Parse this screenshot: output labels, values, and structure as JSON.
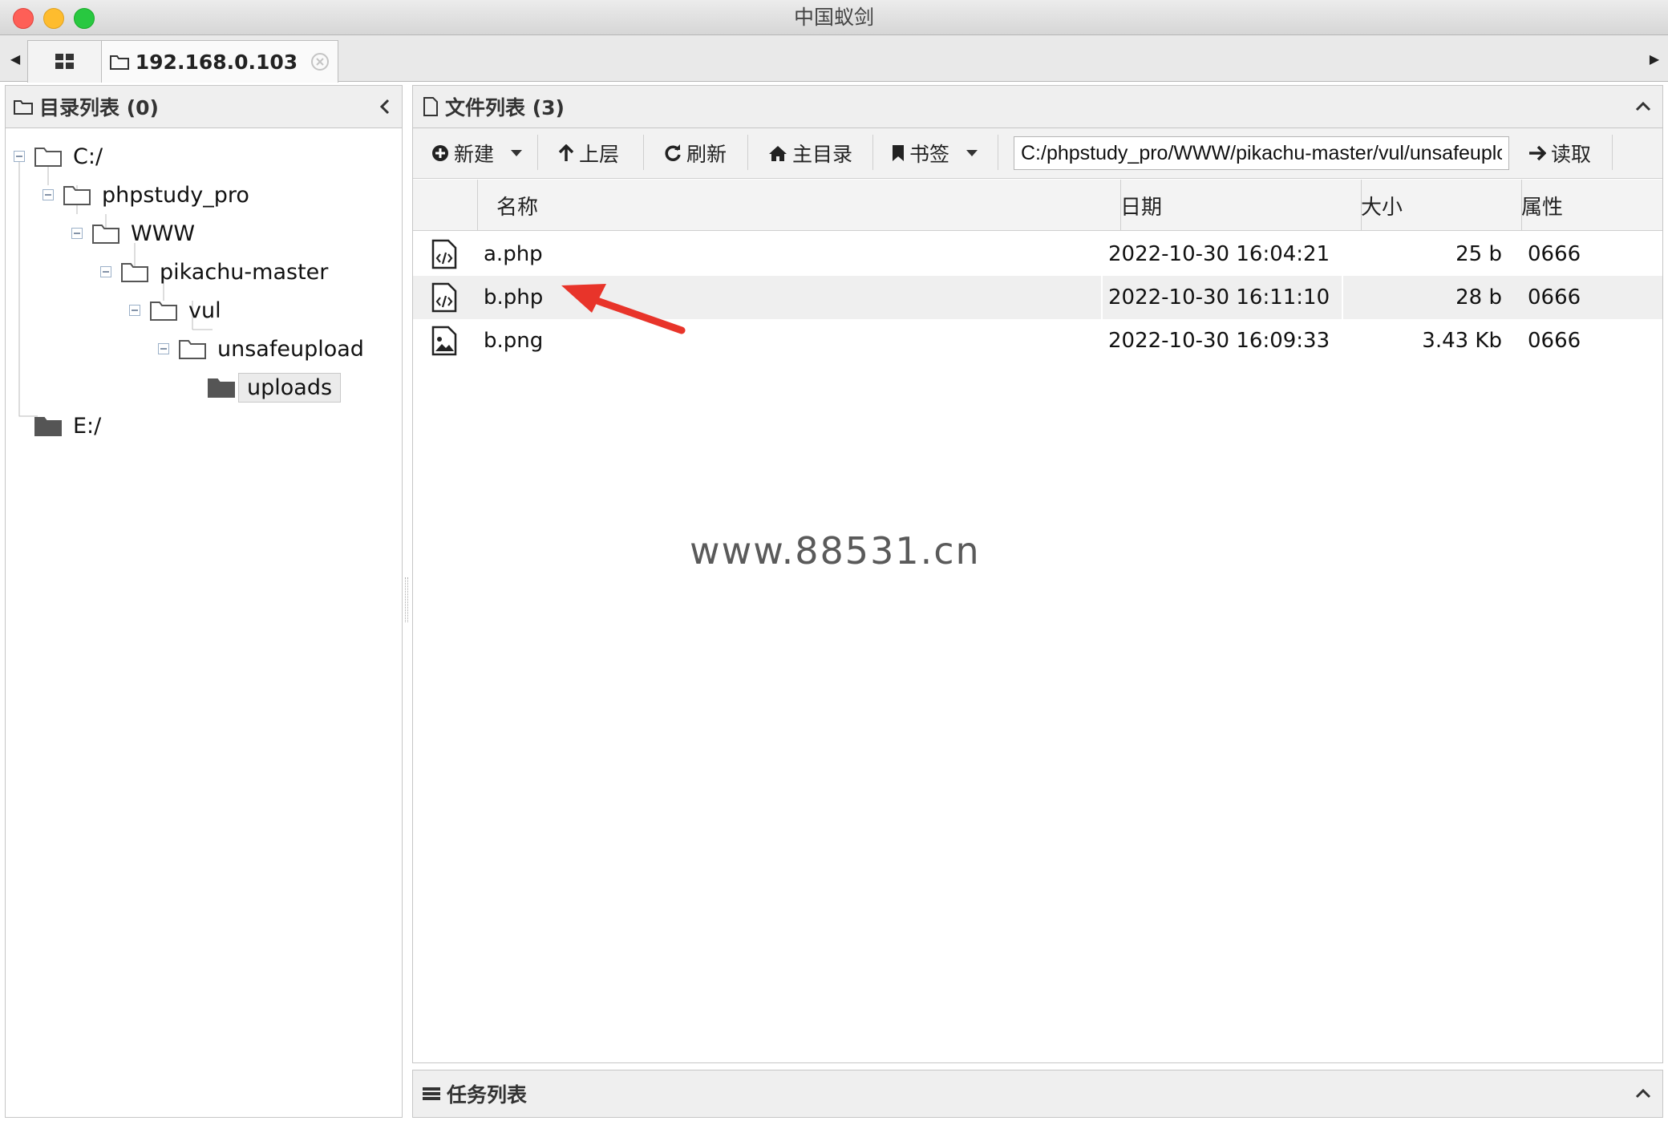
{
  "window": {
    "title": "中国蚁剑"
  },
  "tabs": [
    {
      "icon": "grid-icon"
    },
    {
      "icon": "folder-icon",
      "label": "192.168.0.103"
    }
  ],
  "dir_panel": {
    "title": "目录列表 (0)",
    "tree": [
      {
        "label": "C:/",
        "depth": 0,
        "expanded": true
      },
      {
        "label": "phpstudy_pro",
        "depth": 1,
        "expanded": true
      },
      {
        "label": "WWW",
        "depth": 2,
        "expanded": true
      },
      {
        "label": "pikachu-master",
        "depth": 3,
        "expanded": true
      },
      {
        "label": "vul",
        "depth": 4,
        "expanded": true
      },
      {
        "label": "unsafeupload",
        "depth": 5,
        "expanded": true
      },
      {
        "label": "uploads",
        "depth": 6,
        "selected": true
      },
      {
        "label": "E:/",
        "depth": 0
      }
    ]
  },
  "file_panel": {
    "title": "文件列表 (3)",
    "toolbar": {
      "new_label": "新建",
      "up_label": "上层",
      "refresh_label": "刷新",
      "home_label": "主目录",
      "bookmark_label": "书签",
      "path_value": "C:/phpstudy_pro/WWW/pikachu-master/vul/unsafeuploa",
      "read_label": "读取"
    },
    "columns": {
      "name": "名称",
      "date": "日期",
      "size": "大小",
      "attr": "属性"
    },
    "files": [
      {
        "icon": "code-file-icon",
        "name": "a.php",
        "date": "2022-10-30 16:04:21",
        "size": "25 b",
        "attr": "0666"
      },
      {
        "icon": "code-file-icon",
        "name": "b.php",
        "date": "2022-10-30 16:11:10",
        "size": "28 b",
        "attr": "0666"
      },
      {
        "icon": "image-file-icon",
        "name": "b.png",
        "date": "2022-10-30 16:09:33",
        "size": "3.43 Kb",
        "attr": "0666"
      }
    ]
  },
  "task_panel": {
    "title": "任务列表"
  },
  "watermark": "www.88531.cn",
  "colors": {
    "annotation_arrow": "#e8342a",
    "selected_row": "#efefef"
  }
}
